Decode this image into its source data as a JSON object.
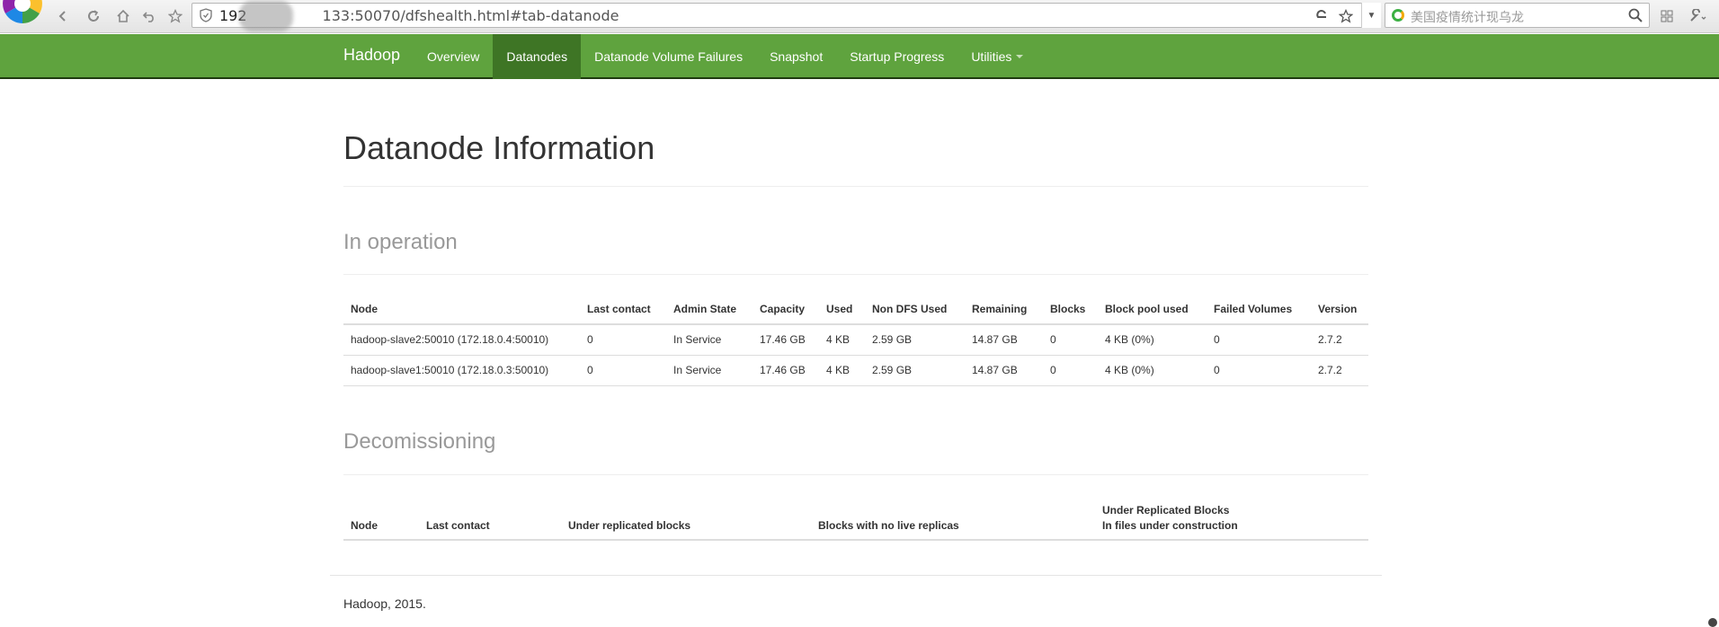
{
  "browser": {
    "url_host": "192",
    "url_rest": "133:50070/dfshealth.html#tab-datanode",
    "search_placeholder": "美国疫情统计现乌龙"
  },
  "navbar": {
    "brand": "Hadoop",
    "items": [
      {
        "label": "Overview",
        "active": false
      },
      {
        "label": "Datanodes",
        "active": true
      },
      {
        "label": "Datanode Volume Failures",
        "active": false
      },
      {
        "label": "Snapshot",
        "active": false
      },
      {
        "label": "Startup Progress",
        "active": false
      },
      {
        "label": "Utilities",
        "active": false
      }
    ],
    "colors": {
      "bar": "#5fa33e",
      "active": "#3e7525"
    }
  },
  "page": {
    "title": "Datanode Information",
    "in_operation": {
      "heading": "In operation",
      "columns": [
        "Node",
        "Last contact",
        "Admin State",
        "Capacity",
        "Used",
        "Non DFS Used",
        "Remaining",
        "Blocks",
        "Block pool used",
        "Failed Volumes",
        "Version"
      ],
      "rows": [
        [
          "hadoop-slave2:50010 (172.18.0.4:50010)",
          "0",
          "In Service",
          "17.46 GB",
          "4 KB",
          "2.59 GB",
          "14.87 GB",
          "0",
          "4 KB (0%)",
          "0",
          "2.7.2"
        ],
        [
          "hadoop-slave1:50010 (172.18.0.3:50010)",
          "0",
          "In Service",
          "17.46 GB",
          "4 KB",
          "2.59 GB",
          "14.87 GB",
          "0",
          "4 KB (0%)",
          "0",
          "2.7.2"
        ]
      ]
    },
    "decomissioning": {
      "heading": "Decomissioning",
      "columns": [
        "Node",
        "Last contact",
        "Under replicated blocks",
        "Blocks with no live replicas",
        "Under Replicated Blocks",
        "In files under construction"
      ]
    },
    "footer": "Hadoop, 2015."
  }
}
